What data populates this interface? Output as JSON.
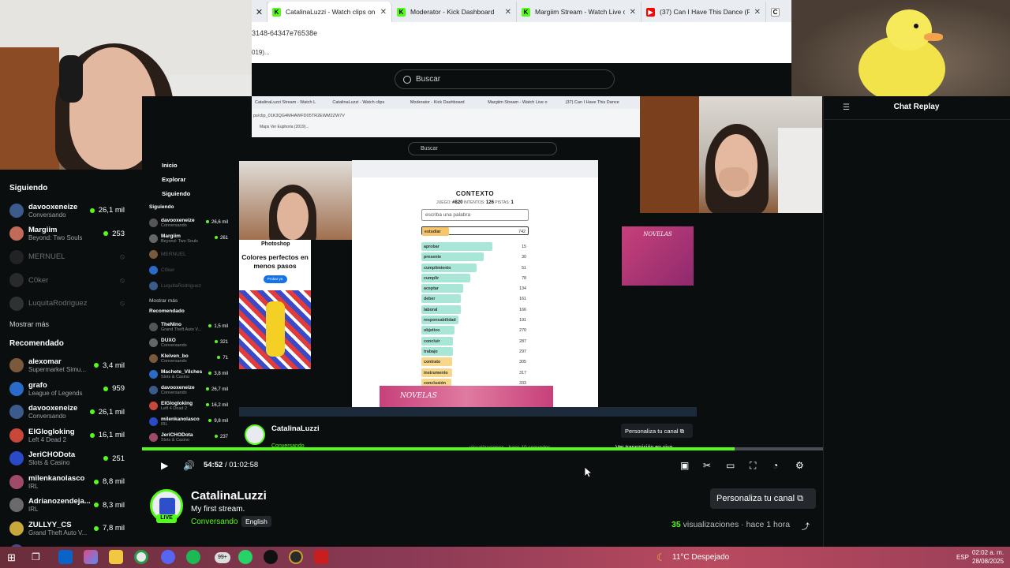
{
  "browser": {
    "tabs": [
      {
        "label": "CatalinaLuzzi - Watch clips on K",
        "icon": "kick"
      },
      {
        "label": "Moderator - Kick Dashboard",
        "icon": "kick"
      },
      {
        "label": "Margiim Stream - Watch Live o",
        "icon": "kick"
      },
      {
        "label": "(37) Can I Have This Dance (Fro",
        "icon": "youtube"
      },
      {
        "label": "C",
        "icon": "other"
      }
    ],
    "url": "3148-64347e76538e",
    "bookmark": "019)..."
  },
  "search": {
    "placeholder": "Buscar"
  },
  "sidebar": {
    "following_heading": "Siguiendo",
    "following": [
      {
        "name": "davooxeneize",
        "sub": "Conversando",
        "count": "26,1 mil",
        "live": true
      },
      {
        "name": "Margiim",
        "sub": "Beyond: Two Souls",
        "count": "253",
        "live": true
      },
      {
        "name": "MERNUEL",
        "sub": "",
        "count": "",
        "live": false
      },
      {
        "name": "C0ker",
        "sub": "",
        "count": "",
        "live": false
      },
      {
        "name": "LuquitaRodriguez",
        "sub": "",
        "count": "",
        "live": false
      }
    ],
    "show_more": "Mostrar más",
    "recommended_heading": "Recomendado",
    "recommended": [
      {
        "name": "alexomar",
        "sub": "Supermarket Simu...",
        "count": "3,4 mil"
      },
      {
        "name": "grafo",
        "sub": "League of Legends",
        "count": "959"
      },
      {
        "name": "davooxeneize",
        "sub": "Conversando",
        "count": "26,1 mil"
      },
      {
        "name": "ElGlogloking",
        "sub": "Left 4 Dead 2",
        "count": "16,1 mil"
      },
      {
        "name": "JeriCHODota",
        "sub": "Slots & Casino",
        "count": "251"
      },
      {
        "name": "milenkanolasco",
        "sub": "IRL",
        "count": "8,8 mil"
      },
      {
        "name": "Adrianozendeja...",
        "sub": "IRL",
        "count": "8,3 mil"
      },
      {
        "name": "ZULLYY_CS",
        "sub": "Grand Theft Auto V...",
        "count": "7,8 mil"
      },
      {
        "name": "TheNino",
        "sub": "",
        "count": "1,5 mil"
      }
    ]
  },
  "nested": {
    "tabs": [
      "CatalinaLuzzi Stream - Watch L",
      "CatalinaLuzzi - Watch clips",
      "Moderator - Kick Dashboard",
      "Margiim Stream - Watch Live o",
      "(37) Can I Have This Dance"
    ],
    "url": "ps/clip_01K3QG4MHAWFD05TR2EWM2ZW7V",
    "bookmarks": "Maps    Ver Euphoria (2019)...",
    "search": "Buscar",
    "mini_nav": [
      "Inicio",
      "Explorar",
      "Siguiendo"
    ],
    "mini_following_heading": "Siguiendo",
    "mini_following": [
      {
        "name": "davooxeneize",
        "sub": "Conversando",
        "count": "26,6 mil"
      },
      {
        "name": "Margiim",
        "sub": "Beyond: Two Souls",
        "count": "261"
      },
      {
        "name": "MERNUEL",
        "sub": "",
        "count": ""
      },
      {
        "name": "C0ker",
        "sub": "",
        "count": ""
      },
      {
        "name": "LuquitaRodriguez",
        "sub": "",
        "count": ""
      }
    ],
    "mini_show_more": "Mostrar más",
    "mini_recommended_heading": "Recomendado",
    "mini_recommended": [
      {
        "name": "TheNino",
        "sub": "Grand Theft Auto V...",
        "count": "1,5 mil"
      },
      {
        "name": "DUXO",
        "sub": "Conversando",
        "count": "321"
      },
      {
        "name": "Kleiven_bo",
        "sub": "Conversando",
        "count": "71"
      },
      {
        "name": "Machete_Vilches",
        "sub": "Slots & Casino",
        "count": "3,8 mil"
      },
      {
        "name": "davooxeneize",
        "sub": "Conversando",
        "count": "26,7 mil"
      },
      {
        "name": "ElGlogloking",
        "sub": "Left 4 Dead 2",
        "count": "16,2 mil"
      },
      {
        "name": "milenkanolasco",
        "sub": "IRL",
        "count": "9,8 mil"
      },
      {
        "name": "JeriCHODota",
        "sub": "Slots & Casino",
        "count": "237"
      }
    ]
  },
  "ad": {
    "brand": "Photoshop",
    "title": "Colores perfectos en menos pasos",
    "button": "Probar ya"
  },
  "game": {
    "title": "CONTEXTO",
    "stats": {
      "game_label": "JUEGO:",
      "game": "#820",
      "attempts_label": "INTENTOS:",
      "attempts": "126",
      "hints_label": "PISTAS:",
      "hints": "1"
    },
    "input_placeholder": "escriba una palabra",
    "last_guess": {
      "word": "estudiar",
      "rank": 742
    },
    "guesses": [
      {
        "word": "aprobar",
        "rank": 15,
        "color": "#a8e6d8"
      },
      {
        "word": "presente",
        "rank": 30,
        "color": "#a8e6d8"
      },
      {
        "word": "cumplimiento",
        "rank": 51,
        "color": "#a8e6d8"
      },
      {
        "word": "cumplir",
        "rank": 78,
        "color": "#a8e6d8"
      },
      {
        "word": "aceptar",
        "rank": 134,
        "color": "#a8e6d8"
      },
      {
        "word": "deber",
        "rank": 161,
        "color": "#a8e6d8"
      },
      {
        "word": "laboral",
        "rank": 166,
        "color": "#a8e6d8"
      },
      {
        "word": "responsabilidad",
        "rank": 191,
        "color": "#a8e6d8"
      },
      {
        "word": "objetivo",
        "rank": 270,
        "color": "#a8e6d8"
      },
      {
        "word": "concluir",
        "rank": 287,
        "color": "#a8e6d8"
      },
      {
        "word": "trabajo",
        "rank": 297,
        "color": "#a8e6d8"
      },
      {
        "word": "contrato",
        "rank": 305,
        "color": "#f7d88a"
      },
      {
        "word": "instrumento",
        "rank": 317,
        "color": "#f7d88a"
      },
      {
        "word": "conclusión",
        "rank": 333,
        "color": "#f7d88a"
      }
    ]
  },
  "novelas": {
    "text": "NOVELAS"
  },
  "inner_stream": {
    "name": "CatalinaLuzzi",
    "category": "Conversando",
    "customize": "Personaliza tu canal",
    "views": "visualizaciones · hace 10 segundos",
    "live_link": "Ver transmisión en vivo"
  },
  "player": {
    "current_time": "54:52",
    "duration": "01:02:58",
    "progress": 0.87
  },
  "channel": {
    "name": "CatalinaLuzzi",
    "title": "My first stream.",
    "category": "Conversando",
    "language": "English",
    "live_badge": "LIVE",
    "customize": "Personaliza tu canal",
    "views_count": "35",
    "views_label": "visualizaciones",
    "age": "hace 1 hora"
  },
  "chat": {
    "title": "Chat Replay"
  },
  "taskbar": {
    "weather": "11°C  Despejado",
    "lang": "ESP",
    "time": "02:02 a. m.",
    "date": "28/08/2025",
    "badge": "99+"
  },
  "colors": {
    "kick_green": "#53fc18",
    "bg": "#0b0e0f"
  }
}
